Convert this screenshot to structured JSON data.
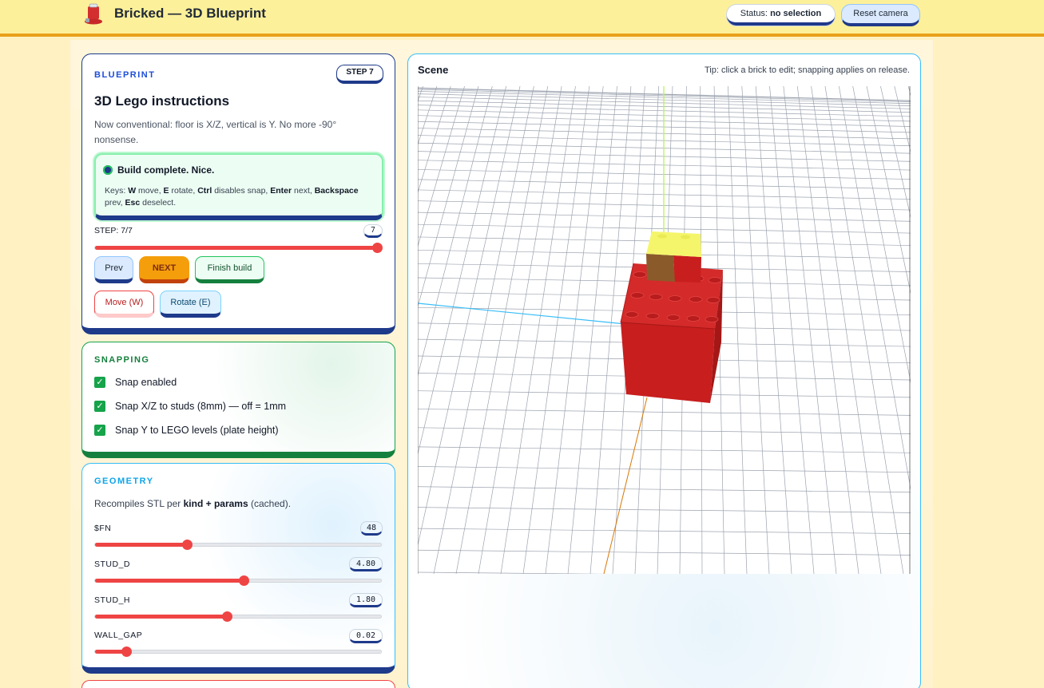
{
  "header": {
    "app_title": "Bricked — 3D Blueprint",
    "status_prefix": "Status:",
    "status_value": "no selection",
    "reset_camera_label": "Reset camera"
  },
  "blueprint": {
    "section_label": "BLUEPRINT",
    "step_badge": "STEP 7",
    "title": "3D Lego instructions",
    "description": "Now conventional: floor is X/Z, vertical is Y. No more -90° nonsense.",
    "build_status": "Build complete. Nice.",
    "keys": {
      "prefix": "Keys:",
      "k1": "W",
      "t1": "move,",
      "k2": "E",
      "t2": "rotate,",
      "k3": "Ctrl",
      "t3": "disables snap,",
      "k4": "Enter",
      "t4": "next,",
      "k5": "Backspace",
      "t5": "prev,",
      "k6": "Esc",
      "t6": "deselect."
    },
    "step_label": "STEP: 7/7",
    "step_value": "7",
    "step_fraction": 1.0,
    "buttons": {
      "prev": "Prev",
      "next": "NEXT",
      "finish": "Finish build",
      "move": "Move (W)",
      "rotate": "Rotate (E)"
    }
  },
  "snapping": {
    "section_label": "SNAPPING",
    "options": [
      {
        "label": "Snap enabled",
        "checked": true
      },
      {
        "label": "Snap X/Z to studs (8mm) — off = 1mm",
        "checked": true
      },
      {
        "label": "Snap Y to LEGO levels (plate height)",
        "checked": true
      }
    ]
  },
  "geometry": {
    "section_label": "GEOMETRY",
    "desc_prefix": "Recompiles STL per",
    "desc_bold": "kind + params",
    "desc_suffix": "(cached).",
    "params": [
      {
        "label": "$FN",
        "value": "48",
        "fraction": 0.32
      },
      {
        "label": "STUD_D",
        "value": "4.80",
        "fraction": 0.52
      },
      {
        "label": "STUD_H",
        "value": "1.80",
        "fraction": 0.46
      },
      {
        "label": "WALL_GAP",
        "value": "0.02",
        "fraction": 0.11
      }
    ]
  },
  "scene": {
    "title": "Scene",
    "tip": "Tip: click a brick to edit; snapping applies on release."
  },
  "colors": {
    "accent_red": "#ef4444",
    "brick_red": "#c81e1e",
    "brick_yellow": "#f5f56b",
    "navy": "#1e3a8a",
    "green": "#16a34a"
  }
}
